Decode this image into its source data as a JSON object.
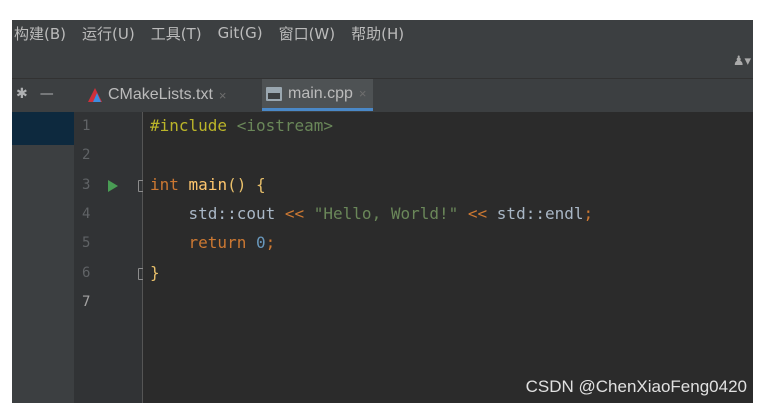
{
  "menubar": {
    "items": [
      "构建(B)",
      "运行(U)",
      "工具(T)",
      "Git(G)",
      "窗口(W)",
      "帮助(H)"
    ]
  },
  "toolbar": {
    "user_icon": "user-icon"
  },
  "tabs": [
    {
      "label": "CMakeLists.txt",
      "icon": "cmake-icon",
      "active": false,
      "close": "×"
    },
    {
      "label": "main.cpp",
      "icon": "cpp-file-icon",
      "active": true,
      "close": "×"
    }
  ],
  "editor": {
    "line_numbers": [
      "1",
      "2",
      "3",
      "4",
      "5",
      "6",
      "7"
    ],
    "current_line": 7,
    "lines": [
      [
        {
          "t": "#include",
          "c": "kw-pre"
        },
        {
          "t": " ",
          "c": "id"
        },
        {
          "t": "<iostream>",
          "c": "str-inc"
        }
      ],
      [],
      [
        {
          "t": "int",
          "c": "kw"
        },
        {
          "t": " ",
          "c": "id"
        },
        {
          "t": "main",
          "c": "fn"
        },
        {
          "t": "() ",
          "c": "brace"
        },
        {
          "t": "{",
          "c": "brace"
        }
      ],
      [
        {
          "t": "    std::cout ",
          "c": "id"
        },
        {
          "t": "<< ",
          "c": "kw"
        },
        {
          "t": "\"Hello, World!\"",
          "c": "str"
        },
        {
          "t": " << ",
          "c": "kw"
        },
        {
          "t": "std::endl",
          "c": "id"
        },
        {
          "t": ";",
          "c": "kw"
        }
      ],
      [
        {
          "t": "    ",
          "c": "id"
        },
        {
          "t": "return",
          "c": "kw"
        },
        {
          "t": " ",
          "c": "id"
        },
        {
          "t": "0",
          "c": "num"
        },
        {
          "t": ";",
          "c": "kw"
        }
      ],
      [
        {
          "t": "}",
          "c": "brace"
        }
      ],
      []
    ]
  },
  "watermark": "CSDN @ChenXiaoFeng0420",
  "colors": {
    "background": "#2b2b2b",
    "keyword": "#cc7832",
    "string": "#6a8759",
    "number": "#6897bb",
    "function": "#ffc66d",
    "preprocessor": "#bbb529",
    "run_gutter": "#499c54"
  }
}
